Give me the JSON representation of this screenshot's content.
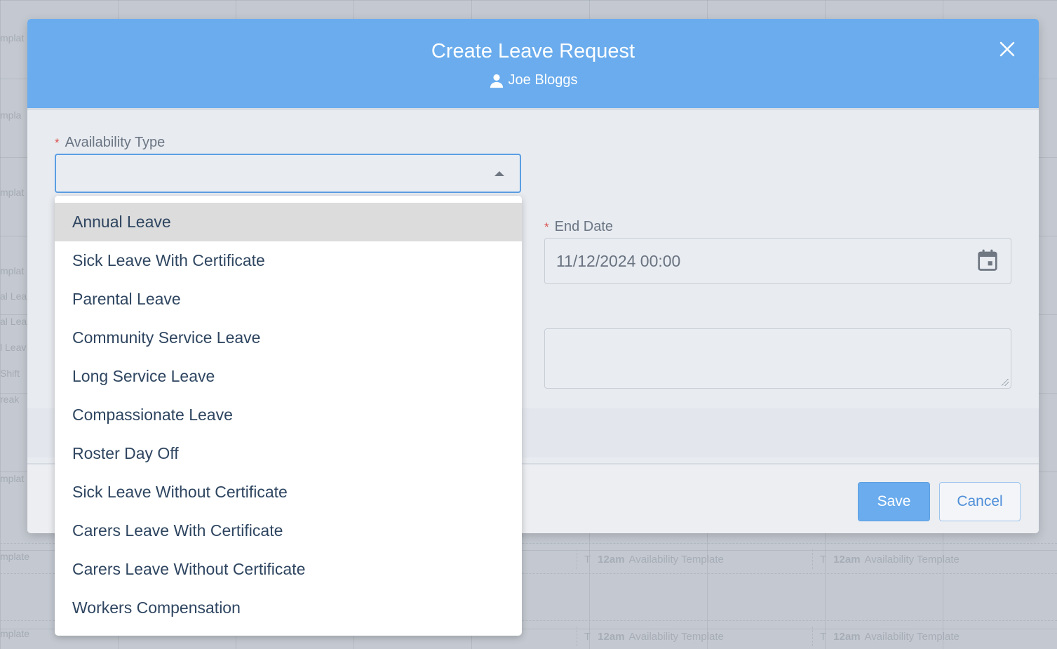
{
  "background": {
    "cell_time": "12am",
    "cell_label": "Availability Template",
    "cell_prefix": "T",
    "left_fragments": [
      "mplat",
      "mpla",
      "mplat",
      "mplat",
      "mplat",
      "al Lea",
      "al Lea",
      "l Leav",
      "Shift",
      "reak",
      "mplat",
      "mplate",
      "mplate"
    ]
  },
  "modal": {
    "title": "Create Leave Request",
    "user_name": "Joe Bloggs",
    "close_icon": "close-icon",
    "availability_type": {
      "label": "Availability Type",
      "required_mark": "*",
      "value": ""
    },
    "end_date": {
      "label": "End Date",
      "required_mark": "*",
      "value": "11/12/2024 00:00"
    },
    "buttons": {
      "save": "Save",
      "cancel": "Cancel"
    }
  },
  "dropdown": {
    "options": [
      "Annual Leave",
      "Sick Leave With Certificate",
      "Parental Leave",
      "Community Service Leave",
      "Long Service Leave",
      "Compassionate Leave",
      "Roster Day Off",
      "Sick Leave Without Certificate",
      "Carers Leave With Certificate",
      "Carers Leave Without Certificate",
      "Workers Compensation"
    ],
    "highlighted": "Annual Leave"
  },
  "colors": {
    "header": "#6aaced",
    "accent": "#5b9ee4",
    "required": "#d9534f"
  }
}
